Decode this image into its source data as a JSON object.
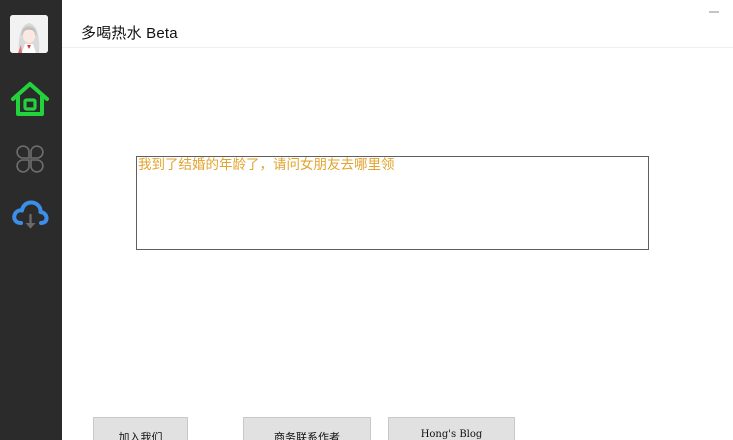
{
  "window": {
    "title": "多喝热水 Beta"
  },
  "sidebar": {
    "avatar_icon": "anime-girl-avatar",
    "items": [
      {
        "icon": "home-icon",
        "color": "#22d33c",
        "state": "active"
      },
      {
        "icon": "four-petal-grid-icon",
        "color": "#6e6e6e",
        "state": "inactive"
      },
      {
        "icon": "cloud-download-icon",
        "color": "#3b8fe8",
        "state": "inactive"
      }
    ]
  },
  "main": {
    "message_text": "我到了结婚的年龄了，请问女朋友去哪里领",
    "text_color": "#e3a32c"
  },
  "buttons": {
    "join_label": "加入我们",
    "contact_label": "商务联系作者",
    "blog_label": "Hong's Blog"
  }
}
